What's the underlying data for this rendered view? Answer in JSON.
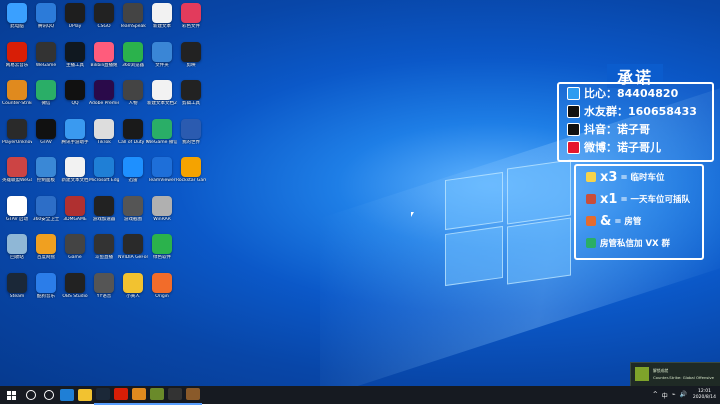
{
  "desktop": {
    "icons": [
      {
        "label": "此电脑",
        "color": "#3aa0ff"
      },
      {
        "label": "网易云音乐",
        "color": "#d81e06"
      },
      {
        "label": "Counter-Strike Global Offensive",
        "color": "#e08a1e"
      },
      {
        "label": "PlayerUnknown's Battlegrounds",
        "color": "#2a2a2a"
      },
      {
        "label": "英雄联盟WeGame",
        "color": "#c44"
      },
      {
        "label": "GTAV 启动",
        "color": "#fff"
      },
      {
        "label": "回收站",
        "color": "#8fb7d6"
      },
      {
        "label": "Steam",
        "color": "#1b2838"
      },
      {
        "label": "腾讯QQ",
        "color": "#2c7bd9"
      },
      {
        "label": "WeGame",
        "color": "#333"
      },
      {
        "label": "微信",
        "color": "#2aae67"
      },
      {
        "label": "GTAV",
        "color": "#111"
      },
      {
        "label": "控制面板",
        "color": "#3a88d6"
      },
      {
        "label": "360安全卫士",
        "color": "#2d6ec7"
      },
      {
        "label": "百度网盘",
        "color": "#f0a020"
      },
      {
        "label": "酷狗音乐",
        "color": "#2b7de9"
      },
      {
        "label": "UPlay",
        "color": "#1e1e1e"
      },
      {
        "label": "主播工具",
        "color": "#101820"
      },
      {
        "label": "QQ",
        "color": "#111"
      },
      {
        "label": "腾讯手游助手",
        "color": "#3a9af0"
      },
      {
        "label": "新建文本文档",
        "color": "#f2f2f2"
      },
      {
        "label": "3DMGAME",
        "color": "#b03030"
      },
      {
        "label": "Game",
        "color": "#444"
      },
      {
        "label": "OBS Studio",
        "color": "#222"
      },
      {
        "label": "CSGO",
        "color": "#222"
      },
      {
        "label": "Bilibili直播姬",
        "color": "#ff5c7c"
      },
      {
        "label": "Adobe Premiere",
        "color": "#2a0a4a"
      },
      {
        "label": "TikTok",
        "color": "#ddd"
      },
      {
        "label": "Microsoft Edge",
        "color": "#1f7fd6"
      },
      {
        "label": "游戏加速器",
        "color": "#222"
      },
      {
        "label": "斗鱼直播",
        "color": "#333"
      },
      {
        "label": "YY语音",
        "color": "#555"
      },
      {
        "label": "TeamSpeak",
        "color": "#444"
      },
      {
        "label": "360浏览器",
        "color": "#2bb24c"
      },
      {
        "label": "人物",
        "color": "#444"
      },
      {
        "label": "Call of Duty Modern Warfare",
        "color": "#1a1a1a"
      },
      {
        "label": "迅雷",
        "color": "#1e90ff"
      },
      {
        "label": "游戏截图",
        "color": "#555"
      },
      {
        "label": "NVIDIA GeForce",
        "color": "#2a2a2a"
      },
      {
        "label": "小黄人",
        "color": "#f2c230"
      },
      {
        "label": "新建文本",
        "color": "#f2f2f2"
      },
      {
        "label": "文件夹",
        "color": "#3a86d6"
      },
      {
        "label": "新建文本文档2",
        "color": "#f2f2f2"
      },
      {
        "label": "WeGame 微信",
        "color": "#2aae67"
      },
      {
        "label": "TeamViewer",
        "color": "#1e6fd9"
      },
      {
        "label": "WinRAR",
        "color": "#b0b0b0"
      },
      {
        "label": "绿色软件",
        "color": "#2bb24c"
      },
      {
        "label": "Origin",
        "color": "#f26c2a"
      },
      {
        "label": "彩色文件",
        "color": "#e23b5c"
      },
      {
        "label": "剪映",
        "color": "#222"
      },
      {
        "label": "剪辑工具",
        "color": "#222"
      },
      {
        "label": "我的世界",
        "color": "#2b5bb0"
      },
      {
        "label": "Rockstar Games Launcher",
        "color": "#f5a300"
      }
    ]
  },
  "promo": {
    "title": "承诺",
    "rows": [
      {
        "icon": "bilibili-icon",
        "color": "#2d9cf0",
        "text": "比心：84404820"
      },
      {
        "icon": "qq-icon",
        "color": "#111111",
        "text": "水友群：160658433"
      },
      {
        "icon": "douyin-icon",
        "color": "#111111",
        "text": "抖音：诺子哥"
      },
      {
        "icon": "weibo-icon",
        "color": "#e6162d",
        "text": "微博：诺子哥儿"
      }
    ]
  },
  "rules": {
    "rows": [
      {
        "big": "x3",
        "text": "= 临时车位",
        "color": "#f6d34a"
      },
      {
        "big": "x1",
        "text": "= 一天车位可插队",
        "color": "#c84e3b"
      },
      {
        "big": "&",
        "text": "= 房管",
        "color": "#e36b2f"
      },
      {
        "big": "",
        "text": "房管私信加 VX 群",
        "color": "#2aae67"
      }
    ]
  },
  "toast": {
    "line1": "解锁成就",
    "line2": "Counter-Strike: Global Offensive"
  },
  "taskbar": {
    "apps": [
      {
        "name": "search",
        "color": "#ffffff"
      },
      {
        "name": "task-view",
        "color": "#ffffff"
      },
      {
        "name": "edge",
        "color": "#1f7fd6"
      },
      {
        "name": "file-explorer",
        "color": "#f2c230"
      },
      {
        "name": "steam",
        "color": "#1b2838"
      },
      {
        "name": "netease",
        "color": "#d81e06"
      },
      {
        "name": "csgo",
        "color": "#e08a1e"
      },
      {
        "name": "gtav",
        "color": "#6a8a2a"
      },
      {
        "name": "obs",
        "color": "#333333"
      },
      {
        "name": "game",
        "color": "#8a5a2a"
      }
    ],
    "tray": [
      "^",
      "中",
      "⌁",
      "🔊"
    ],
    "time": "12:01",
    "date": "2020/8/14"
  },
  "colors": {
    "accent": "#0b5ccd",
    "taskbar": "#161a21"
  }
}
